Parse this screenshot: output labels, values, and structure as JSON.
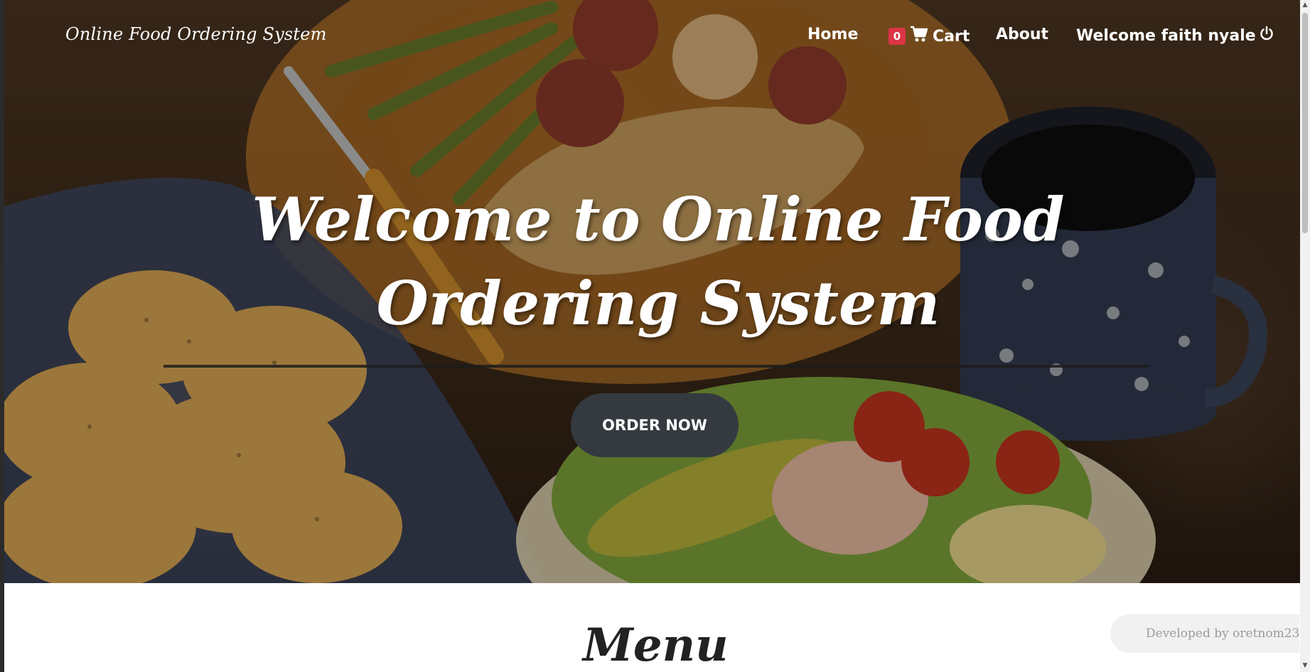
{
  "navbar": {
    "brand": "Online Food Ordering System",
    "links": {
      "home": "Home",
      "cart_count": "0",
      "cart": "Cart",
      "about": "About",
      "welcome": "Welcome faith nyale"
    },
    "icons": {
      "cart": "shopping-cart-icon",
      "logout": "power-icon"
    }
  },
  "hero": {
    "title": "Welcome to Online Food Ordering System",
    "button": "ORDER NOW"
  },
  "menu": {
    "title": "Menu"
  },
  "footer_badge": {
    "text": "Developed by oretnom23"
  },
  "colors": {
    "button_bg": "#343a40",
    "badge_bg": "#dc3545",
    "nav_text": "#ffffff"
  }
}
